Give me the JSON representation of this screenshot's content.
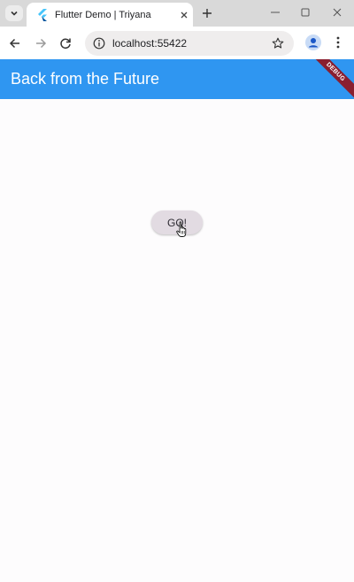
{
  "browser": {
    "tab_title": "Flutter Demo | Triyana",
    "url": "localhost:55422"
  },
  "app": {
    "title": "Back from the Future",
    "debug_label": "DEBUG",
    "go_button_label": "GO!",
    "appbar_color": "#2f96f1",
    "background_color": "#fdfcfd"
  },
  "icons": {
    "tab_search": "chevron-down-icon",
    "favicon": "flutter-logo-icon",
    "tab_close": "close-icon",
    "new_tab": "plus-icon",
    "minimize": "minimize-icon",
    "maximize": "maximize-icon",
    "close_window": "close-icon",
    "back": "arrow-left-icon",
    "forward": "arrow-right-icon",
    "reload": "reload-icon",
    "site_info": "info-icon",
    "bookmark": "star-icon",
    "profile": "profile-icon",
    "menu": "kebab-icon",
    "cursor": "hand-pointer-icon"
  }
}
